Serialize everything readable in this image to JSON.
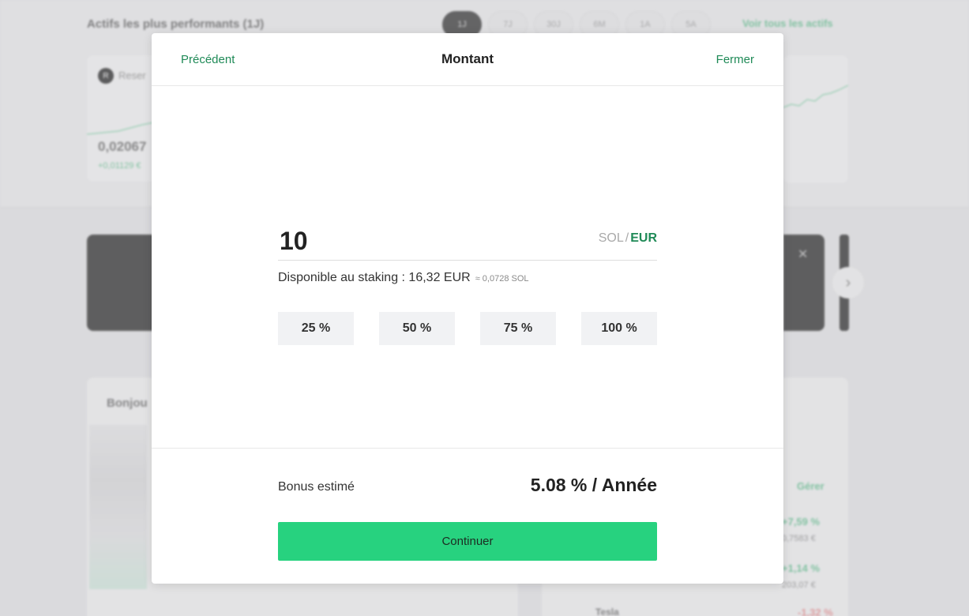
{
  "background": {
    "heading": "Actifs les plus performants (1J)",
    "ranges": [
      "1J",
      "7J",
      "30J",
      "6M",
      "1A",
      "5A"
    ],
    "active_range": "1J",
    "view_all": "Voir tous les actifs",
    "asset_icon_letter": "R",
    "asset_name": "Reser",
    "asset_price": "0,02067",
    "asset_change": "+0,01129 €",
    "hello": "Bonjou",
    "manage": "Gérer",
    "rows": [
      {
        "pct": "+7,59 %",
        "sub": "0,7583 €"
      },
      {
        "pct": "+1,14 %",
        "sub": "203,07 €"
      }
    ],
    "tesla": "Tesla",
    "red_pct": "-1,32 %"
  },
  "modal": {
    "back_label": "Précédent",
    "title": "Montant",
    "close_label": "Fermer",
    "amount_value": "10",
    "unit_sol": "SOL",
    "unit_separator": "/",
    "unit_eur": "EUR",
    "available_text": "Disponible au staking : 16,32 EUR",
    "available_approx": "≈ 0,0728 SOL",
    "percent_buttons": [
      "25 %",
      "50 %",
      "75 %",
      "100 %"
    ],
    "bonus_label": "Bonus estimé",
    "bonus_value": "5.08 % / Année",
    "continue_label": "Continuer"
  }
}
